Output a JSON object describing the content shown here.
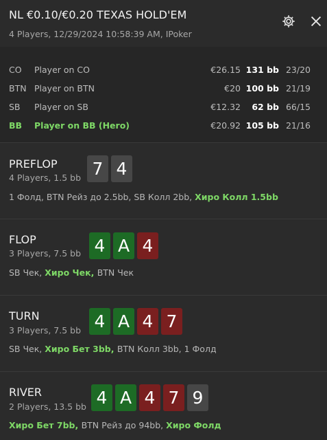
{
  "header": {
    "title": "NL €0.10/€0.20 TEXAS HOLD'EM",
    "subtitle": "4 Players, 12/29/2024 10:58:39 AM, IPoker",
    "settings_icon": "gear-icon",
    "close_icon": "close-icon"
  },
  "players": [
    {
      "position": "CO",
      "name": "Player on CO",
      "stack": "€26.15",
      "bb": "131 bb",
      "stats": "23/20",
      "hero": false
    },
    {
      "position": "BTN",
      "name": "Player on BTN",
      "stack": "€20",
      "bb": "100 bb",
      "stats": "21/19",
      "hero": false
    },
    {
      "position": "SB",
      "name": "Player on SB",
      "stack": "€12.32",
      "bb": "62 bb",
      "stats": "66/15",
      "hero": false
    },
    {
      "position": "BB",
      "name": "Player on BB (Hero)",
      "stack": "€20.92",
      "bb": "105 bb",
      "stats": "21/16",
      "hero": true
    }
  ],
  "streets": [
    {
      "name": "PREFLOP",
      "info": "4 Players, 1.5 bb",
      "cards": [
        {
          "rank": "7",
          "color": "gray"
        },
        {
          "rank": "4",
          "color": "gray"
        }
      ],
      "actions": [
        {
          "text": "1 Фолд, BTN Рейз до 2.5bb, SB Колл 2bb, ",
          "hero": false
        },
        {
          "text": "Хиро Колл 1.5bb",
          "hero": true
        }
      ]
    },
    {
      "name": "FLOP",
      "info": "3 Players, 7.5 bb",
      "cards": [
        {
          "rank": "4",
          "color": "green"
        },
        {
          "rank": "A",
          "color": "green"
        },
        {
          "rank": "4",
          "color": "red"
        }
      ],
      "actions": [
        {
          "text": "SB Чек, ",
          "hero": false
        },
        {
          "text": "Хиро Чек, ",
          "hero": true
        },
        {
          "text": "BTN Чек",
          "hero": false
        }
      ]
    },
    {
      "name": "TURN",
      "info": "3 Players, 7.5 bb",
      "cards": [
        {
          "rank": "4",
          "color": "green"
        },
        {
          "rank": "A",
          "color": "green"
        },
        {
          "rank": "4",
          "color": "red"
        },
        {
          "rank": "7",
          "color": "red"
        }
      ],
      "actions": [
        {
          "text": "SB Чек, ",
          "hero": false
        },
        {
          "text": "Хиро Бет 3bb, ",
          "hero": true
        },
        {
          "text": "BTN Колл 3bb, 1 Фолд",
          "hero": false
        }
      ]
    },
    {
      "name": "RIVER",
      "info": "2 Players, 13.5 bb",
      "cards": [
        {
          "rank": "4",
          "color": "green"
        },
        {
          "rank": "A",
          "color": "green"
        },
        {
          "rank": "4",
          "color": "red"
        },
        {
          "rank": "7",
          "color": "red"
        },
        {
          "rank": "9",
          "color": "gray"
        }
      ],
      "actions": [
        {
          "text": "Хиро Бет 7bb, ",
          "hero": true
        },
        {
          "text": "BTN Рейз до 94bb, ",
          "hero": false
        },
        {
          "text": "Хиро Фолд",
          "hero": true
        }
      ]
    }
  ],
  "colors": {
    "hero_text": "#7ed866",
    "card_gray": "#474747",
    "card_green": "#1d6b25",
    "card_red": "#7a1f1f",
    "background": "#2b2b2b"
  }
}
